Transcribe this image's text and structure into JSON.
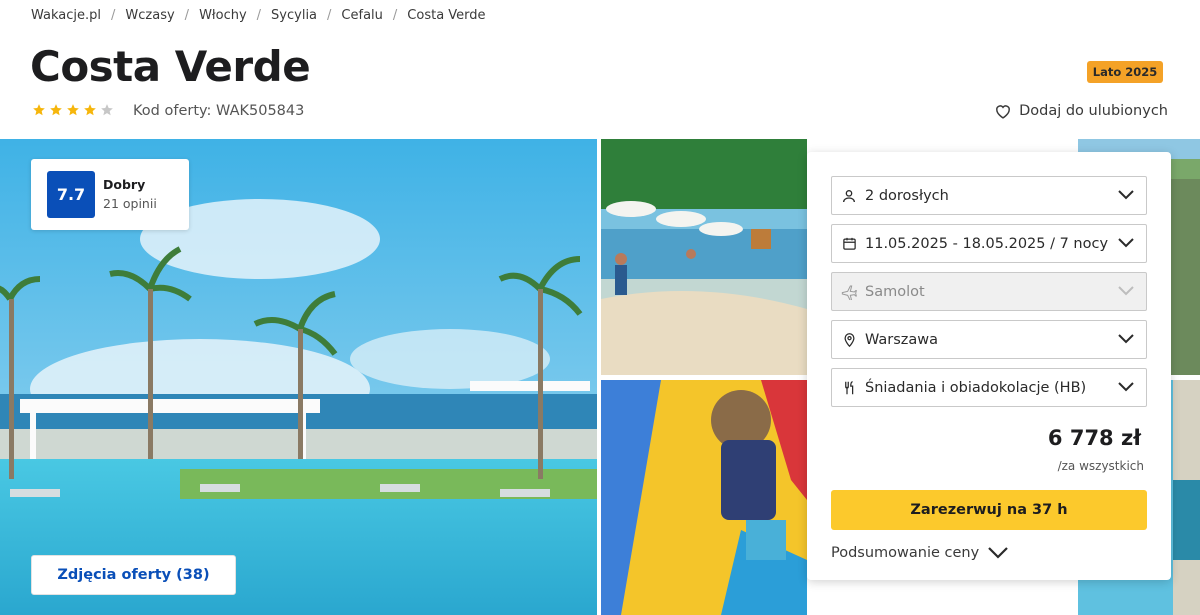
{
  "breadcrumb": [
    "Wakacje.pl",
    "Wczasy",
    "Włochy",
    "Sycylia",
    "Cefalu",
    "Costa Verde"
  ],
  "hotel": {
    "name": "Costa Verde",
    "stars": 4,
    "offer_code": "Kod oferty: WAK505843"
  },
  "season_badge": "Lato 2025",
  "favorite_label": "Dodaj do ulubionych",
  "rating": {
    "score": "7.7",
    "label": "Dobry",
    "count": "21 opinii"
  },
  "photos_button": "Zdjęcia oferty (38)",
  "booking": {
    "guests": "2 dorosłych",
    "dates": "11.05.2025 - 18.05.2025 / 7 nocy",
    "transport": "Samolot",
    "departure": "Warszawa",
    "board": "Śniadania i obiadokolacje (HB)",
    "price": "6 778 zł",
    "price_note": "/za wszystkich",
    "book_button": "Zarezerwuj na 37 h",
    "summary_link": "Podsumowanie ceny"
  },
  "colors": {
    "brand_blue": "#0a4fb8",
    "cta_yellow": "#fcc92c",
    "badge_orange": "#f4a227",
    "star_yellow": "#f6b60c"
  }
}
